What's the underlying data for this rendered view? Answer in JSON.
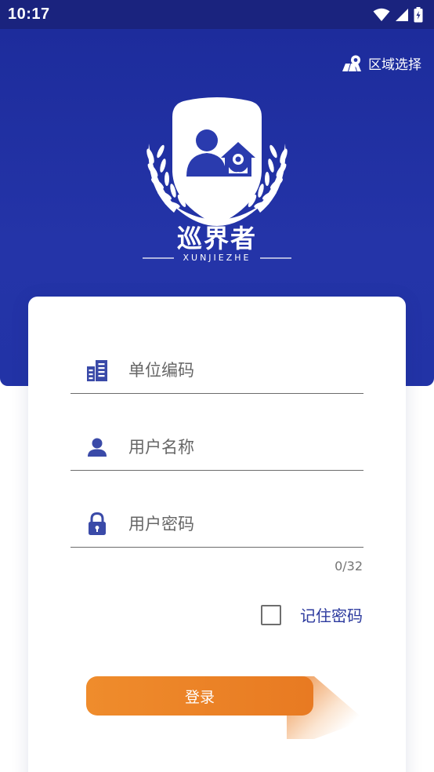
{
  "status": {
    "time": "10:17"
  },
  "header": {
    "region_select_label": "区域选择",
    "logo_title": "巡界者",
    "logo_subtitle": "XUNJIEZHE"
  },
  "form": {
    "unit_code_placeholder": "单位编码",
    "username_placeholder": "用户名称",
    "password_placeholder": "用户密码",
    "password_counter": "0/32",
    "remember_label": "记住密码",
    "login_label": "登录"
  },
  "colors": {
    "primary": "#1d2c9c",
    "accent": "#e87a22",
    "icon": "#3949ab"
  },
  "icons": {
    "region": "map-pin-icon",
    "unit": "building-icon",
    "user": "person-icon",
    "password": "lock-icon"
  }
}
